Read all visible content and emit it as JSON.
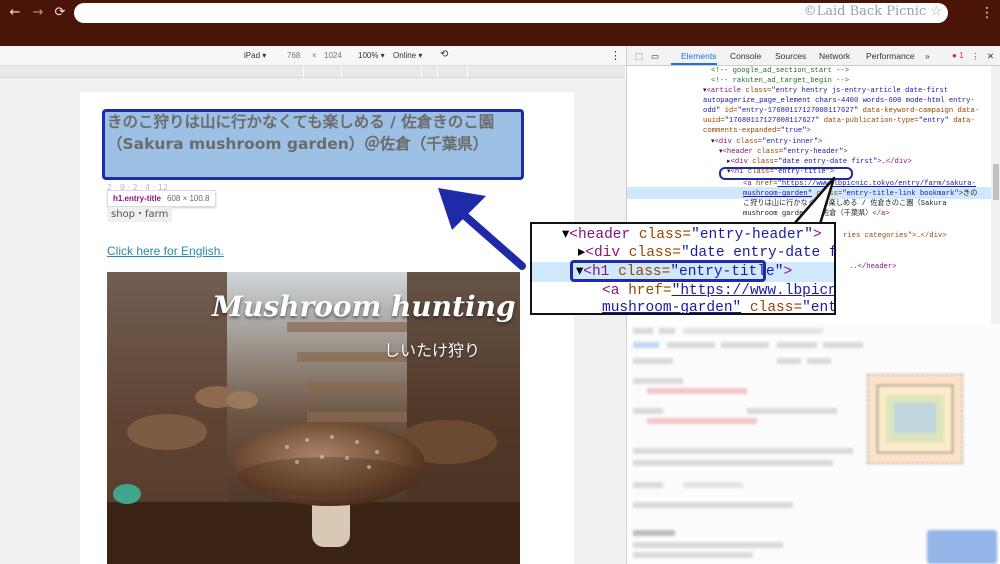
{
  "browser": {
    "nav_back": "←",
    "nav_forward": "→",
    "nav_reload": "⟳",
    "watermark": "©Laid Back Picnic",
    "star": "☆",
    "menu": "⋮"
  },
  "device_toolbar": {
    "device": "iPad ▾",
    "width": "768",
    "times": "×",
    "height": "1024",
    "zoom": "100% ▾",
    "network": "Online ▾"
  },
  "page": {
    "title": "きのこ狩りは山に行かなくても楽しめる / 佐倉きのこ園（Sakura mushroom garden）＠佐倉（千葉県）",
    "tooltip_selector": "h1.entry-title",
    "tooltip_size": "608 × 100.8",
    "category": "shop・farm",
    "english_link": "Click here for English.",
    "hero_title": "Mushroom hunting",
    "hero_subtitle": "しいたけ狩り"
  },
  "devtools": {
    "tabs": [
      "Elements",
      "Console",
      "Sources",
      "Network",
      "Performance",
      "»"
    ],
    "active_tab": "Elements",
    "error_count": "1",
    "lines": {
      "l1": "<!-- google_ad_section_start -->",
      "l2": "<!-- rakuten_ad_target_begin -->",
      "l3a": "<article",
      "l3b": " class=",
      "l3c": "\"entry hentry js-entry-article date-first",
      "l4": "autopagerize_page_element chars-4400 words-600 mode-html entry-",
      "l5a": "odd\"",
      "l5b": " id=",
      "l5c": "\"entry-17680117127008117627\"",
      "l5d": " data-keyword-campaign data-",
      "l6a": "uuid=",
      "l6b": "\"17680117127008117627\"",
      "l6c": " data-publication-type=",
      "l6d": "\"entry\"",
      "l6e": " data-",
      "l7a": "comments-expanded=",
      "l7b": "\"true\"",
      "l7c": ">",
      "l8a": "<div",
      "l8b": " class=",
      "l8c": "\"entry-inner\"",
      "l8d": ">",
      "l9a": "<header",
      "l9b": " class=",
      "l9c": "\"entry-header\"",
      "l9d": ">",
      "l10a": "<div",
      "l10b": " class=",
      "l10c": "\"date entry-date first\"",
      "l10d": ">…</div>",
      "l11a": "<h1",
      "l11b": " class=",
      "l11c": "\"entry-title\"",
      "l11d": ">",
      "l12a": "<a",
      "l12b": " href=",
      "l12c": "\"https://www.lbpicnic.tokyo/entry/farm/sakura-",
      "l13a": "mushroom-garden\"",
      "l13b": " class=",
      "l13c": "\"entry-title-link bookmark\"",
      "l13d": ">きの",
      "l14": "こ狩りは山に行かなくても楽しめる / 佐倉きのこ園（Sakura",
      "l15": "mushroom garden）＠佐倉（千葉県）",
      "l15b": "</a>",
      "l16": "ries categories\">…</div>",
      "l17": "..</header>"
    }
  },
  "zoom_callout": {
    "z1a": "<header",
    "z1b": " class=",
    "z1c": "\"entry-header\"",
    "z1d": ">",
    "z2a": "<div",
    "z2b": " class=",
    "z2c": "\"date entry-date first",
    "z3a": "<h1",
    "z3b": " class=",
    "z3c": "\"entry-title\"",
    "z3d": ">",
    "z4a": "<a",
    "z4b": " href=",
    "z4c": "\"https://www.lbpicnic.t",
    "z5a": "mushroom-garden\"",
    "z5b": " class=",
    "z5c": "\"entry-t"
  },
  "colors": {
    "chrome_bar": "#4a1408",
    "highlight_fill": "#9cc1e4",
    "annotation_blue": "#1e2aa8",
    "link": "#2a8aa8"
  }
}
